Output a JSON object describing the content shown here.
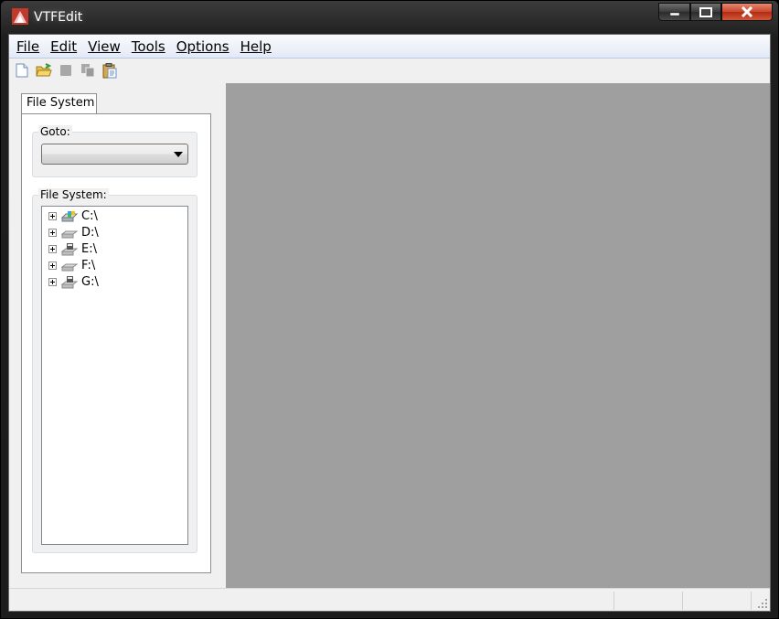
{
  "window": {
    "title": "VTFEdit",
    "colors": {
      "frame": "#1e1e1e",
      "client_bg": "#f0f0f0",
      "workspace_bg": "#9f9f9f",
      "close_red": "#c9462c"
    }
  },
  "caption_buttons": {
    "minimize_icon": "minimize-icon",
    "maximize_icon": "maximize-icon",
    "close_icon": "close-icon"
  },
  "menu": {
    "items": [
      {
        "label": "File"
      },
      {
        "label": "Edit"
      },
      {
        "label": "View"
      },
      {
        "label": "Tools"
      },
      {
        "label": "Options"
      },
      {
        "label": "Help"
      }
    ]
  },
  "toolbar": {
    "buttons": [
      {
        "icon": "new-file-icon",
        "enabled": true
      },
      {
        "icon": "open-folder-icon",
        "enabled": true
      },
      {
        "icon": "save-icon",
        "enabled": false
      },
      {
        "icon": "copy-icon",
        "enabled": false
      },
      {
        "icon": "paste-icon",
        "enabled": true
      }
    ]
  },
  "sidebar": {
    "tab_label": "File System",
    "goto": {
      "label": "Goto:",
      "value": ""
    },
    "file_system": {
      "label": "File System:",
      "drives": [
        {
          "label": "C:\\",
          "icon": "system-drive-icon"
        },
        {
          "label": "D:\\",
          "icon": "removable-drive-icon"
        },
        {
          "label": "E:\\",
          "icon": "optical-drive-icon"
        },
        {
          "label": "F:\\",
          "icon": "removable-drive-icon"
        },
        {
          "label": "G:\\",
          "icon": "optical-drive-icon"
        }
      ]
    }
  }
}
